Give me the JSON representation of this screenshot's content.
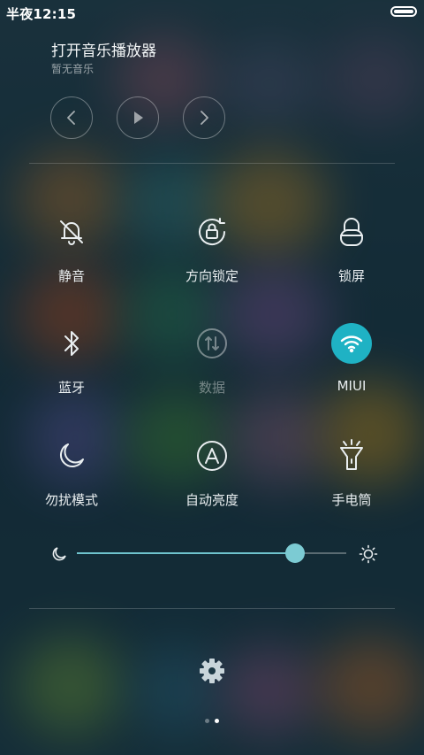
{
  "status_bar": {
    "time": "半夜12:15"
  },
  "music": {
    "title": "打开音乐播放器",
    "subtitle": "暂无音乐",
    "controls": [
      "prev-icon",
      "play-icon",
      "next-icon"
    ]
  },
  "toggles": [
    {
      "label": "静音",
      "icon": "bell-off-icon",
      "state": "off"
    },
    {
      "label": "方向锁定",
      "icon": "rotation-lock-icon",
      "state": "off"
    },
    {
      "label": "锁屏",
      "icon": "lock-icon",
      "state": "off"
    },
    {
      "label": "蓝牙",
      "icon": "bluetooth-icon",
      "state": "off"
    },
    {
      "label": "数据",
      "icon": "mobile-data-icon",
      "state": "disabled"
    },
    {
      "label": "MIUI",
      "icon": "wifi-icon",
      "state": "on"
    },
    {
      "label": "勿扰模式",
      "icon": "moon-icon",
      "state": "off"
    },
    {
      "label": "自动亮度",
      "icon": "auto-brightness-icon",
      "state": "off"
    },
    {
      "label": "手电筒",
      "icon": "flashlight-icon",
      "state": "off"
    }
  ],
  "brightness": {
    "level_fraction": 0.81
  },
  "pager": {
    "count": 2,
    "active_index": 1
  },
  "colors": {
    "accent": "#1fb2c4",
    "slider_fill": "#6fc3cd"
  }
}
